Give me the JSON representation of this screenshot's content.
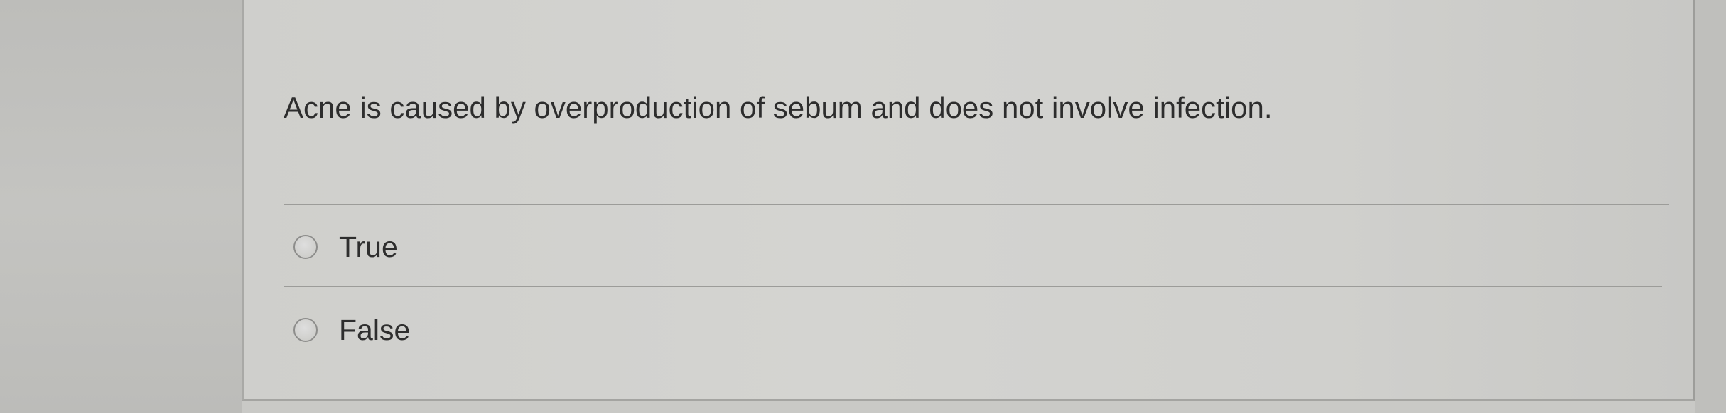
{
  "question": {
    "text": "Acne is caused by overproduction of sebum and does not involve infection."
  },
  "options": [
    {
      "label": "True",
      "selected": false
    },
    {
      "label": "False",
      "selected": false
    }
  ],
  "colors": {
    "background": "#c9c9c6",
    "card": "#d2d2cf",
    "text": "#2d2d2d",
    "divider": "#9c9c99"
  }
}
